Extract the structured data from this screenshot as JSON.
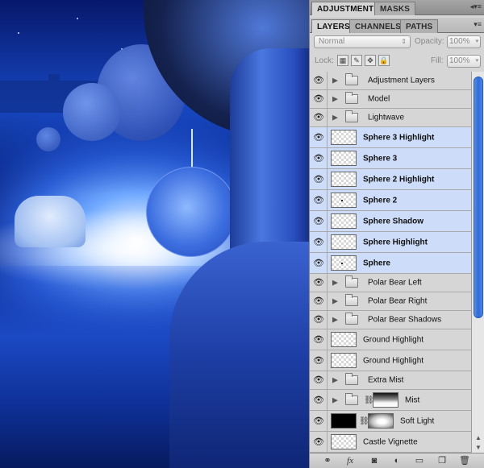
{
  "panel": {
    "top_tabs": [
      "ADJUSTMENTS",
      "MASKS"
    ],
    "second_tabs": [
      "LAYERS",
      "CHANNELS",
      "PATHS"
    ],
    "blend_mode": "Normal",
    "opacity_label": "Opacity:",
    "opacity_value": "100%",
    "lock_label": "Lock:",
    "fill_label": "Fill:",
    "fill_value": "100%"
  },
  "layers": [
    {
      "name": "Adjustment Layers",
      "type": "group",
      "selected": false
    },
    {
      "name": "Model",
      "type": "group",
      "selected": false
    },
    {
      "name": "Lightwave",
      "type": "group",
      "selected": false
    },
    {
      "name": "Sphere 3 Highlight",
      "type": "layer",
      "selected": true
    },
    {
      "name": "Sphere 3",
      "type": "layer",
      "selected": true
    },
    {
      "name": "Sphere 2 Highlight",
      "type": "layer",
      "selected": true
    },
    {
      "name": "Sphere 2",
      "type": "layer",
      "selected": true
    },
    {
      "name": "Sphere Shadow",
      "type": "layer",
      "selected": true
    },
    {
      "name": "Sphere Highlight",
      "type": "layer",
      "selected": true
    },
    {
      "name": "Sphere",
      "type": "layer",
      "selected": true
    },
    {
      "name": "Polar Bear Left",
      "type": "group",
      "selected": false
    },
    {
      "name": "Polar Bear Right",
      "type": "group",
      "selected": false
    },
    {
      "name": "Polar Bear Shadows",
      "type": "group",
      "selected": false
    },
    {
      "name": "Ground Highlight",
      "type": "layer",
      "selected": false
    },
    {
      "name": "Ground Highlight",
      "type": "layer",
      "selected": false
    },
    {
      "name": "Extra Mist",
      "type": "group",
      "selected": false
    },
    {
      "name": "Mist",
      "type": "group-masked",
      "selected": false
    },
    {
      "name": "Soft Light",
      "type": "layer-masked",
      "selected": false
    },
    {
      "name": "Castle Vignette",
      "type": "layer",
      "selected": false
    }
  ],
  "footer_icons": [
    "link-layers-icon",
    "fx-icon",
    "add-mask-icon",
    "adjustment-layer-icon",
    "new-group-icon",
    "new-layer-icon",
    "trash-icon"
  ],
  "colors": {
    "selection": "#cddcf8",
    "panel": "#d6d6d6",
    "scroll_thumb": "#2e6bd6"
  }
}
